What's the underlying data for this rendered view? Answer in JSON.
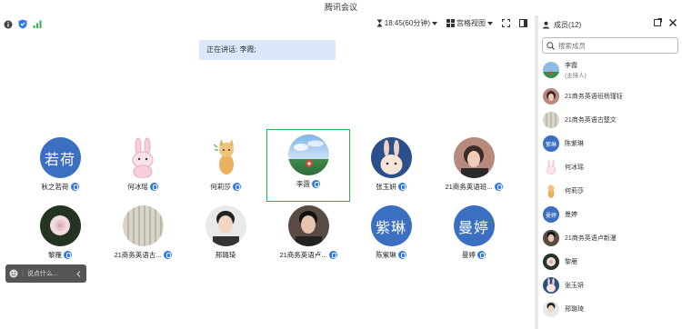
{
  "window": {
    "title": "腾讯会议"
  },
  "toolbar": {
    "time": "18:45(60分钟)",
    "view": "宫格视图"
  },
  "speaking": {
    "text": "正在讲话: 李霞;"
  },
  "participants": [
    {
      "name": "秋之若荷",
      "avatar_text": "若荷"
    },
    {
      "name": "何冰瑶",
      "avatar_text": ""
    },
    {
      "name": "何莉莎",
      "avatar_text": ""
    },
    {
      "name": "李霞",
      "avatar_text": ""
    },
    {
      "name": "张玉妍",
      "avatar_text": ""
    },
    {
      "name": "21商务英语班...",
      "avatar_text": ""
    },
    {
      "name": "黎雁",
      "avatar_text": ""
    },
    {
      "name": "21商务英语古...",
      "avatar_text": ""
    },
    {
      "name": "邢璐琦",
      "avatar_text": ""
    },
    {
      "name": "21商务英语卢...",
      "avatar_text": ""
    },
    {
      "name": "陈紫琳",
      "avatar_text": "紫琳"
    },
    {
      "name": "曼婷",
      "avatar_text": "曼婷"
    }
  ],
  "chat": {
    "placeholder": "说点什么..."
  },
  "panel": {
    "title": "成员(12)",
    "search_placeholder": "搜索成员",
    "members": [
      {
        "name": "李霞",
        "sub": "(主持人)",
        "avatar_text": ""
      },
      {
        "name": "21商务英语班杨瑾钰",
        "avatar_text": ""
      },
      {
        "name": "21商务英语古楚文",
        "avatar_text": ""
      },
      {
        "name": "陈紫琳",
        "avatar_text": "紫琳"
      },
      {
        "name": "何冰瑶",
        "avatar_text": ""
      },
      {
        "name": "何莉莎",
        "avatar_text": ""
      },
      {
        "name": "曼婷",
        "avatar_text": "曼婷"
      },
      {
        "name": "21商务英语卢新漫",
        "avatar_text": ""
      },
      {
        "name": "黎雁",
        "avatar_text": ""
      },
      {
        "name": "张玉妍",
        "avatar_text": ""
      },
      {
        "name": "邢璐琦",
        "avatar_text": ""
      }
    ]
  },
  "colors": {
    "accent": "#2f7ae5",
    "active_border": "#22b94a",
    "avatar_blue": "#3b6fc2"
  }
}
